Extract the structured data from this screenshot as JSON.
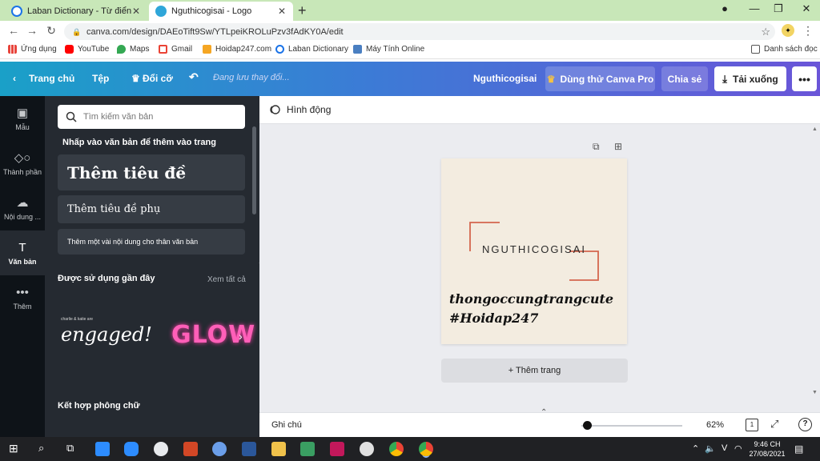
{
  "browser": {
    "tabs": [
      {
        "label": "Laban Dictionary - Từ điển Anh V",
        "active": false
      },
      {
        "label": "Nguthicogisai - Logo",
        "active": true
      }
    ],
    "new_tab": "+",
    "close_glyph": "✕",
    "window_controls": [
      "—",
      "❐",
      "✕"
    ],
    "url": "canva.com/design/DAEoTift9Sw/YTLpeiKROLuPzv3fAdKY0A/edit",
    "bookmarks": [
      {
        "label": "Ứng dụng",
        "icon": "apps-grid-icon"
      },
      {
        "label": "YouTube",
        "icon": "youtube-icon"
      },
      {
        "label": "Maps",
        "icon": "maps-pin-icon"
      },
      {
        "label": "Gmail",
        "icon": "gmail-icon"
      },
      {
        "label": "Hoidap247.com",
        "icon": "hoidap-icon"
      },
      {
        "label": "Laban Dictionary",
        "icon": "laban-icon"
      },
      {
        "label": "Máy Tính Online",
        "icon": "calculator-icon"
      }
    ],
    "reading_list": "Danh sách đọc"
  },
  "topbar": {
    "home": "Trang chủ",
    "file": "Tệp",
    "resize": "Đổi cỡ",
    "saving": "Đang lưu thay đổi...",
    "title": "Nguthicogisai",
    "try_pro": "Dùng thử Canva Pro",
    "share": "Chia sẻ",
    "download": "Tải xuống",
    "more": "•••"
  },
  "rail": [
    {
      "label": "Mẫu",
      "icon": "template-icon"
    },
    {
      "label": "Thành phần",
      "icon": "elements-icon"
    },
    {
      "label": "Nội dung ...",
      "icon": "upload-cloud-icon"
    },
    {
      "label": "Văn bản",
      "icon": "text-icon",
      "active": true
    },
    {
      "label": "Thêm",
      "icon": "more-dots-icon"
    }
  ],
  "panel": {
    "search_placeholder": "Tìm kiếm văn bản",
    "hint": "Nhấp vào văn bản để thêm vào trang",
    "heading": "Thêm tiêu đề",
    "subheading": "Thêm tiêu đề phụ",
    "body": "Thêm một vài nội dung cho thân văn bản",
    "recent_title": "Được sử dụng gần đây",
    "see_all": "Xem tất cả",
    "recent_1_small": "charlie & katie are",
    "recent_1_big": "engaged!",
    "recent_2": "GLOW",
    "combo_title": "Kết hợp phông chữ"
  },
  "workspace": {
    "animate": "Hình động",
    "logo_text": "NGUTHICOGISAI",
    "script_1": "thongoccungtrangcute",
    "script_2": "#Hoidap247",
    "add_page": "+ Thêm trang",
    "accent_color": "#d4664e",
    "page_bg": "#f3ece0"
  },
  "bottombar": {
    "notes": "Ghi chú",
    "zoom_label": "62%",
    "zoom": 0.06,
    "page_count": "1",
    "help": "?"
  },
  "taskbar": {
    "tray_input": "V",
    "time": "9:46 CH",
    "date": "27/08/2021"
  }
}
